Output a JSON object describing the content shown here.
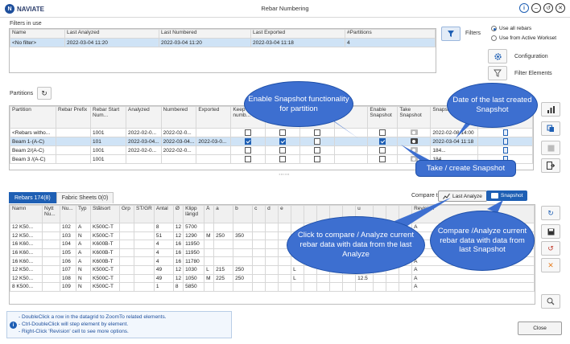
{
  "window": {
    "app_name": "NAVIATE",
    "title": "Rebar Numbering"
  },
  "filters": {
    "section_label": "Filters in use",
    "columns": [
      "Name",
      "Last Analyzed",
      "Last Numbered",
      "Last Exported",
      "#Partitions"
    ],
    "rows": [
      [
        "<No filter>",
        "2022-03-04 11:20",
        "2022-03-04 11:20",
        "2022-03-04 11:18",
        "4"
      ]
    ],
    "filters_label": "Filters",
    "radio_all": "Use all rebars",
    "radio_workset": "Use from Active Workset",
    "configuration_label": "Configuration",
    "filter_elements_label": "Filter Elements"
  },
  "partitions": {
    "section_label": "Partitions",
    "columns": [
      "Partition",
      "Rebar Prefix",
      "Rebar Start Num...",
      "Analyzed",
      "Numbered",
      "Exported",
      "Keep numb...",
      "",
      "",
      "",
      "Enable Snapshot",
      "Take Snapshot",
      "Snapshot",
      ""
    ],
    "rows": [
      {
        "name": "<Rebars witho...",
        "prefix": "",
        "start": "1001",
        "analyzed": "2022-02-0...",
        "numbered": "2022-02-0...",
        "exported": "",
        "snapshot": "2022-02-08 14:00",
        "snap_short": "",
        "keep": false,
        "c2": false,
        "c3": false,
        "c4": false,
        "enable": false,
        "take_active": false
      },
      {
        "name": "Beam 1-(A-C)",
        "prefix": "",
        "start": "101",
        "analyzed": "2022-03-04...",
        "numbered": "2022-03-04...",
        "exported": "2022-03-0...",
        "snapshot": "2022-03-04 11:18",
        "snap_short": "",
        "keep": true,
        "c2": true,
        "c3": false,
        "c4": false,
        "enable": true,
        "take_active": true
      },
      {
        "name": "Beam 2/(A-C)",
        "prefix": "",
        "start": "1001",
        "analyzed": "2022-02-0...",
        "numbered": "2022-02-0...",
        "exported": "",
        "snapshot": "",
        "snap_short": "184...",
        "keep": false,
        "c2": false,
        "c3": false,
        "c4": false,
        "enable": false,
        "take_active": false
      },
      {
        "name": "Beam 3 /(A-C)",
        "prefix": "",
        "start": "1001",
        "analyzed": "",
        "numbered": "",
        "exported": "",
        "snapshot": "",
        "snap_short": "184...",
        "keep": false,
        "c2": false,
        "c3": false,
        "c4": false,
        "enable": false,
        "take_active": false
      }
    ]
  },
  "rebars": {
    "tab_rebars": "Rebars 174(8)",
    "tab_fabric": "Fabric Sheets 0(0)",
    "compare_label": "Compare to:",
    "last_analyze_btn": "Last Analyze",
    "snapshot_btn": "Snapshot",
    "columns": [
      "Namn",
      "Nytt Nu...",
      "Nu...",
      "Typ",
      "Stålsort",
      "Grp",
      "ST/GR",
      "Antal",
      "Ø",
      "Klipp längd",
      "Å",
      "a",
      "b",
      "c",
      "d",
      "e",
      "",
      "",
      "",
      "",
      "",
      "u",
      "",
      "",
      "",
      "Revision"
    ],
    "rows": [
      [
        "12 K50...",
        "",
        "102",
        "A",
        "K500C-T",
        "",
        "",
        "8",
        "12",
        "5700",
        "",
        "",
        "",
        "",
        "",
        "",
        "",
        "",
        "",
        "",
        "",
        "",
        "",
        "",
        "",
        "A"
      ],
      [
        "12 K50...",
        "",
        "103",
        "N",
        "K500C-T",
        "",
        "",
        "51",
        "12",
        "1290",
        "M",
        "250",
        "350",
        "",
        "",
        "",
        "",
        "",
        "",
        "",
        "",
        "",
        "",
        "",
        "",
        "A"
      ],
      [
        "16 K60...",
        "",
        "104",
        "A",
        "K600B-T",
        "",
        "",
        "4",
        "16",
        "11950",
        "",
        "",
        "",
        "",
        "",
        "",
        "",
        "",
        "",
        "",
        "",
        "",
        "",
        "",
        "",
        "A"
      ],
      [
        "16 K60...",
        "",
        "105",
        "A",
        "K600B-T",
        "",
        "",
        "4",
        "16",
        "11950",
        "",
        "",
        "",
        "",
        "",
        "",
        "",
        "",
        "",
        "",
        "",
        "",
        "",
        "",
        "",
        "A"
      ],
      [
        "16 K60...",
        "",
        "106",
        "A",
        "K600B-T",
        "",
        "",
        "4",
        "16",
        "11780",
        "",
        "",
        "",
        "",
        "",
        "",
        "",
        "",
        "",
        "",
        "",
        "",
        "",
        "",
        "",
        "A"
      ],
      [
        "12 K50...",
        "",
        "107",
        "N",
        "K500C-T",
        "",
        "",
        "49",
        "12",
        "1030",
        "L",
        "215",
        "250",
        "",
        "",
        "",
        "L",
        "",
        "",
        "",
        "",
        "12.5",
        "",
        "",
        "",
        "A"
      ],
      [
        "12 K50...",
        "",
        "108",
        "N",
        "K500C-T",
        "",
        "",
        "49",
        "12",
        "1050",
        "M",
        "225",
        "250",
        "",
        "",
        "",
        "L",
        "",
        "",
        "",
        "",
        "12.5",
        "",
        "",
        "",
        "A"
      ],
      [
        "8 K500...",
        "",
        "109",
        "N",
        "K500C-T",
        "",
        "",
        "1",
        "8",
        "5850",
        "",
        "",
        "",
        "",
        "",
        "",
        "",
        "",
        "",
        "",
        "",
        "",
        "",
        "",
        "",
        "A"
      ]
    ]
  },
  "info": {
    "lines": [
      "- DoubleClick a row in the datagrid to ZoomTo related elements.",
      "- Ctrl-DoubleClick will step element by element.",
      "- Right-Click 'Revision' cell to see more options."
    ]
  },
  "close_label": "Close",
  "callouts": {
    "enable_snapshot": "Enable Snapshot functionality for partition",
    "date_snapshot": "Date of the last created Snapshot",
    "take_snapshot": "Take / create Snapshot",
    "compare_analyze": "Click to compare / Analyze current rebar data with data from the last Analyze",
    "compare_snapshot": "Compare /Analyze current rebar data with data from last Snapshot"
  },
  "icons": {
    "logo": "naviate-logo-icon",
    "info": "info-icon",
    "filter": "funnel-icon",
    "configuration": "gear-icon",
    "filter_elements": "funnel-outline-icon",
    "refresh": "refresh-icon",
    "zoom": "magnifier-icon",
    "close_window": "close-icon",
    "minimize": "minimize-icon",
    "back": "back-icon"
  },
  "colors": {
    "accent": "#1e5fb4",
    "callout": "#3d6fd0",
    "selected_row": "#cfe3f6"
  }
}
